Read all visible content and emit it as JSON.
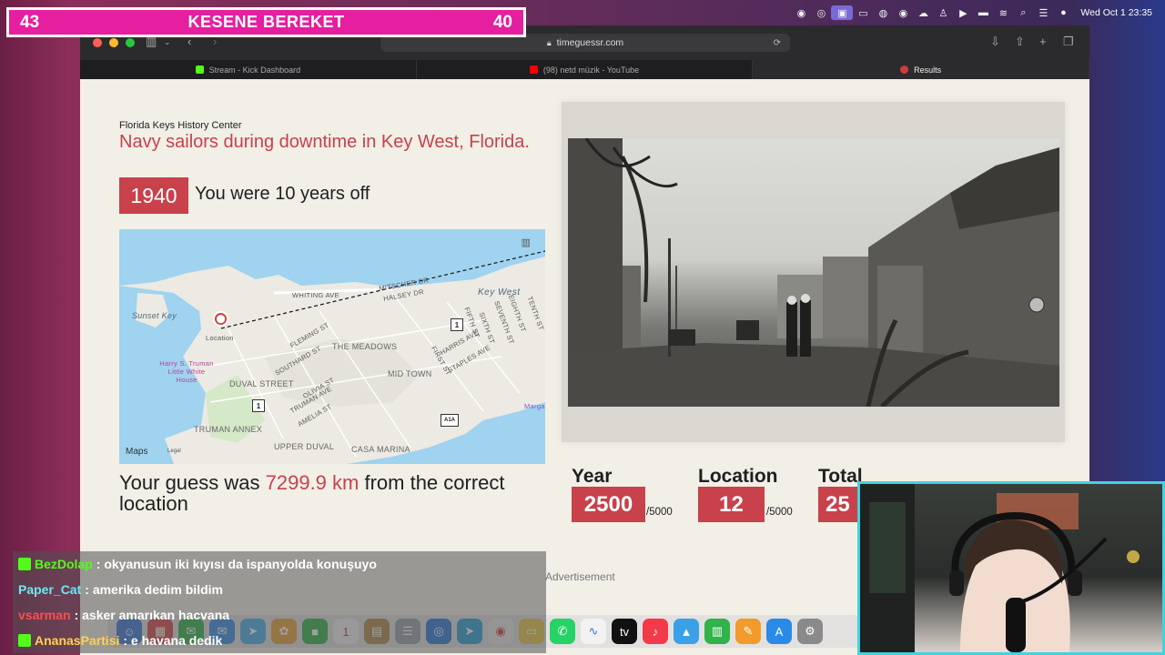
{
  "overlay": {
    "left_count": "43",
    "title": "KESENE BEREKET",
    "right_count": "40"
  },
  "menubar": {
    "clock": "Wed Oct 1  23:35"
  },
  "browser": {
    "url": "timeguessr.com",
    "tabs": [
      {
        "label": "Stream - Kick Dashboard",
        "color": "#53fc18"
      },
      {
        "label": "(98) netd müzik - YouTube",
        "color": "#ff0000"
      },
      {
        "label": "Results",
        "color": "#d23a3a"
      }
    ]
  },
  "result": {
    "source": "Florida Keys History Center",
    "headline": "Navy sailors during downtime in Key West, Florida.",
    "year": "1940",
    "years_off": "You were 10 years off",
    "guess_prefix": "Your guess was ",
    "guess_distance": "7299.9 km",
    "guess_suffix": " from the correct location"
  },
  "map": {
    "labels": {
      "key_west": "Key West",
      "sunset_key": "Sunset Key",
      "location": "Location",
      "truman": "Harry S. Truman Little White House",
      "duval": "DUVAL STREET",
      "meadows": "THE MEADOWS",
      "midtown": "MID TOWN",
      "truman_annex": "TRUMAN ANNEX",
      "upper_duval": "UPPER DUVAL",
      "casa_marina": "CASA MARINA",
      "whiting": "WHITING AVE",
      "mitscher": "MITSCHER DR",
      "halsey": "HALSEY DR",
      "fleming": "FLEMING ST",
      "southard": "SOUTHARD ST",
      "olivia": "OLIVIA ST",
      "truman_ave": "TRUMAN AVE",
      "amelia": "AMELIA ST",
      "first": "FIRST ST",
      "harris": "HARRIS AVE",
      "staples": "STAPLES AVE",
      "fifth": "FIFTH ST",
      "sixth": "SIXTH ST",
      "seventh": "SEVENTH ST",
      "eighth": "EIGHTH ST",
      "tenth": "TENTH ST",
      "marga": "Marga",
      "us1": "1",
      "a1a": "A1A"
    },
    "maps_logo": "Maps",
    "legal": "Legal"
  },
  "scores": {
    "year_label": "Year",
    "year_score": "2500",
    "year_of": "/5000",
    "location_label": "Location",
    "location_score": "12",
    "location_of": "/5000",
    "total_label": "Total",
    "total_score": "25"
  },
  "ad_label": "Advertisement",
  "chat": [
    {
      "user": "BezDolap",
      "text": ": okyanusun iki kıyısı da ispanyolda konuşuyo",
      "color": "#53fc18"
    },
    {
      "user": "Paper_Cat",
      "text": ": amerika dedim bildim",
      "color": "#6ee7f0"
    },
    {
      "user": "vsarman",
      "text": ": asker amarıkan hacvana",
      "color": "#ff4d4d"
    },
    {
      "user": "AnanasPartisi",
      "text": ": e havana dedik",
      "color": "#ffd24d"
    }
  ],
  "colors": {
    "accent": "#c8414b",
    "overlay": "#e61ea0",
    "cam_border": "#3fd3e0"
  }
}
